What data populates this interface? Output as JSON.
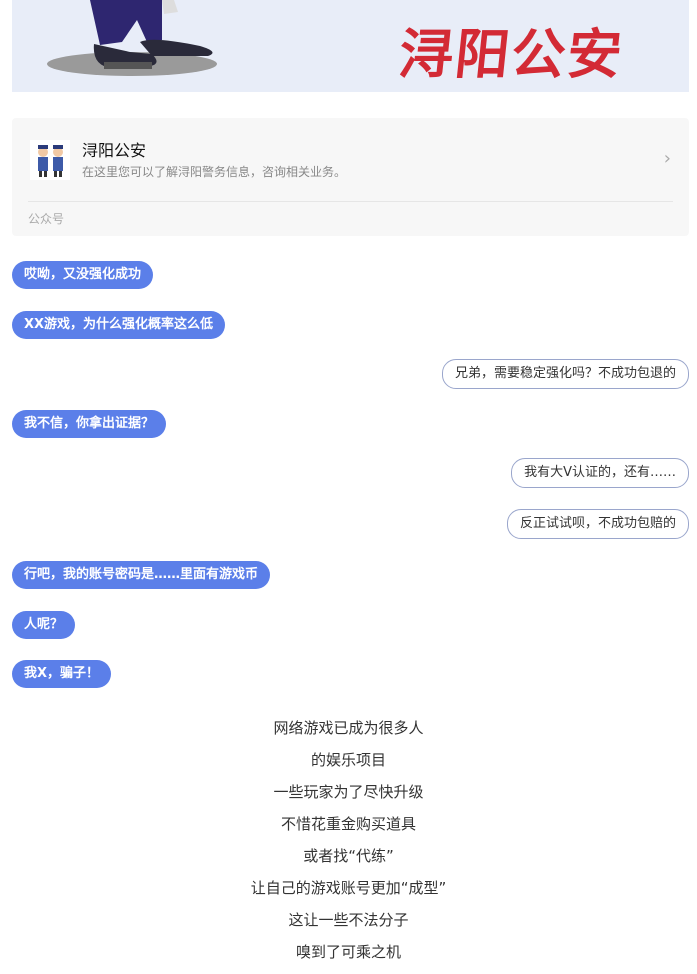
{
  "banner": {
    "title": "浔阳公安"
  },
  "account": {
    "name": "浔阳公安",
    "description": "在这里您可以了解浔阳警务信息，咨询相关业务。",
    "type_label": "公众号",
    "arrow": "›"
  },
  "chat": [
    {
      "side": "left",
      "text": "哎呦，又没强化成功"
    },
    {
      "side": "left",
      "text": "XX游戏，为什么强化概率这么低"
    },
    {
      "side": "right",
      "text": "兄弟，需要稳定强化吗？不成功包退的"
    },
    {
      "side": "left",
      "text": "我不信，你拿出证据？"
    },
    {
      "side": "right",
      "text": "我有大V认证的，还有……"
    },
    {
      "side": "right",
      "text": "反正试试呗，不成功包赔的"
    },
    {
      "side": "left",
      "text": "行吧，我的账号密码是……里面有游戏币"
    },
    {
      "side": "left",
      "text": "人呢？"
    },
    {
      "side": "left",
      "text": "我X，骗子！"
    }
  ],
  "article_lines": [
    "网络游戏已成为很多人",
    "的娱乐项目",
    "一些玩家为了尽快升级",
    "不惜花重金购买道具",
    "或者找“代练”",
    "让自己的游戏账号更加“成型”",
    "这让一些不法分子",
    "嗅到了可乘之机"
  ],
  "colors": {
    "bubble_left": "#5b7fe9",
    "banner_text": "#d32a35",
    "banner_bg": "#e8edf8"
  }
}
